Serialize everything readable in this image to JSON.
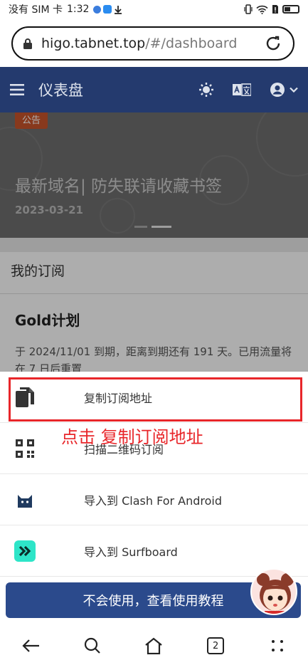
{
  "status_bar": {
    "carrier": "没有 SIM 卡",
    "time": "1:32"
  },
  "url_bar": {
    "host": "higo.tabnet.top",
    "path": "/#/dashboard"
  },
  "header": {
    "title": "仪表盘"
  },
  "banner": {
    "badge": "公告",
    "title": "最新域名| 防失联请收藏书签",
    "date": "2023-03-21"
  },
  "subscription": {
    "heading": "我的订阅",
    "plan_name": "Gold计划",
    "info": "于 2024/11/01 到期，距离到期还有 191 天。已用流量将在 7 日后重置"
  },
  "sheet": {
    "items": [
      {
        "label": "复制订阅地址",
        "icon": "copy-icon"
      },
      {
        "label": "扫描二维码订阅",
        "icon": "qrcode-icon"
      },
      {
        "label": "导入到 Clash For Android",
        "icon": "clash-cat-icon"
      },
      {
        "label": "导入到 Surfboard",
        "icon": "surfboard-icon"
      }
    ],
    "help_button": "不会使用，查看使用教程"
  },
  "annotation": "点击 复制订阅地址",
  "bottom_nav": {
    "tab_count": "2"
  },
  "colors": {
    "header_bg": "#243a6e",
    "help_button_bg": "#2b4a8c",
    "annotation_red": "#e8262a",
    "surfboard_green": "#2ee5c8"
  }
}
